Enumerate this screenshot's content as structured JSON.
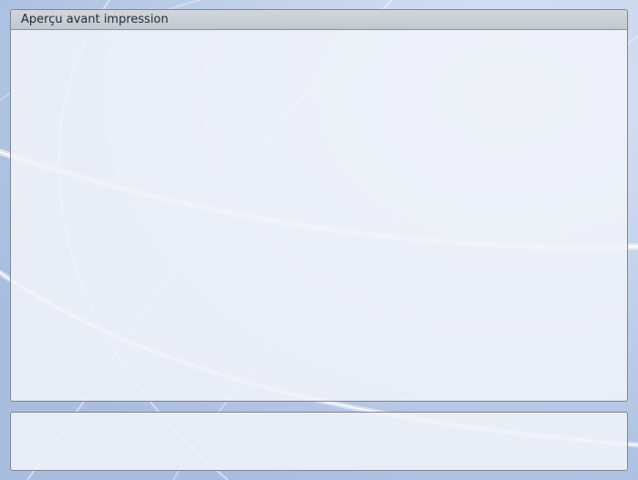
{
  "preview": {
    "title": "Aperçu avant impression"
  },
  "colors": {
    "background": "#b7c8e6",
    "panel": "#f0f3f8",
    "header": "#c8ccd3",
    "border": "#7d8592",
    "text": "#1f2a38"
  }
}
